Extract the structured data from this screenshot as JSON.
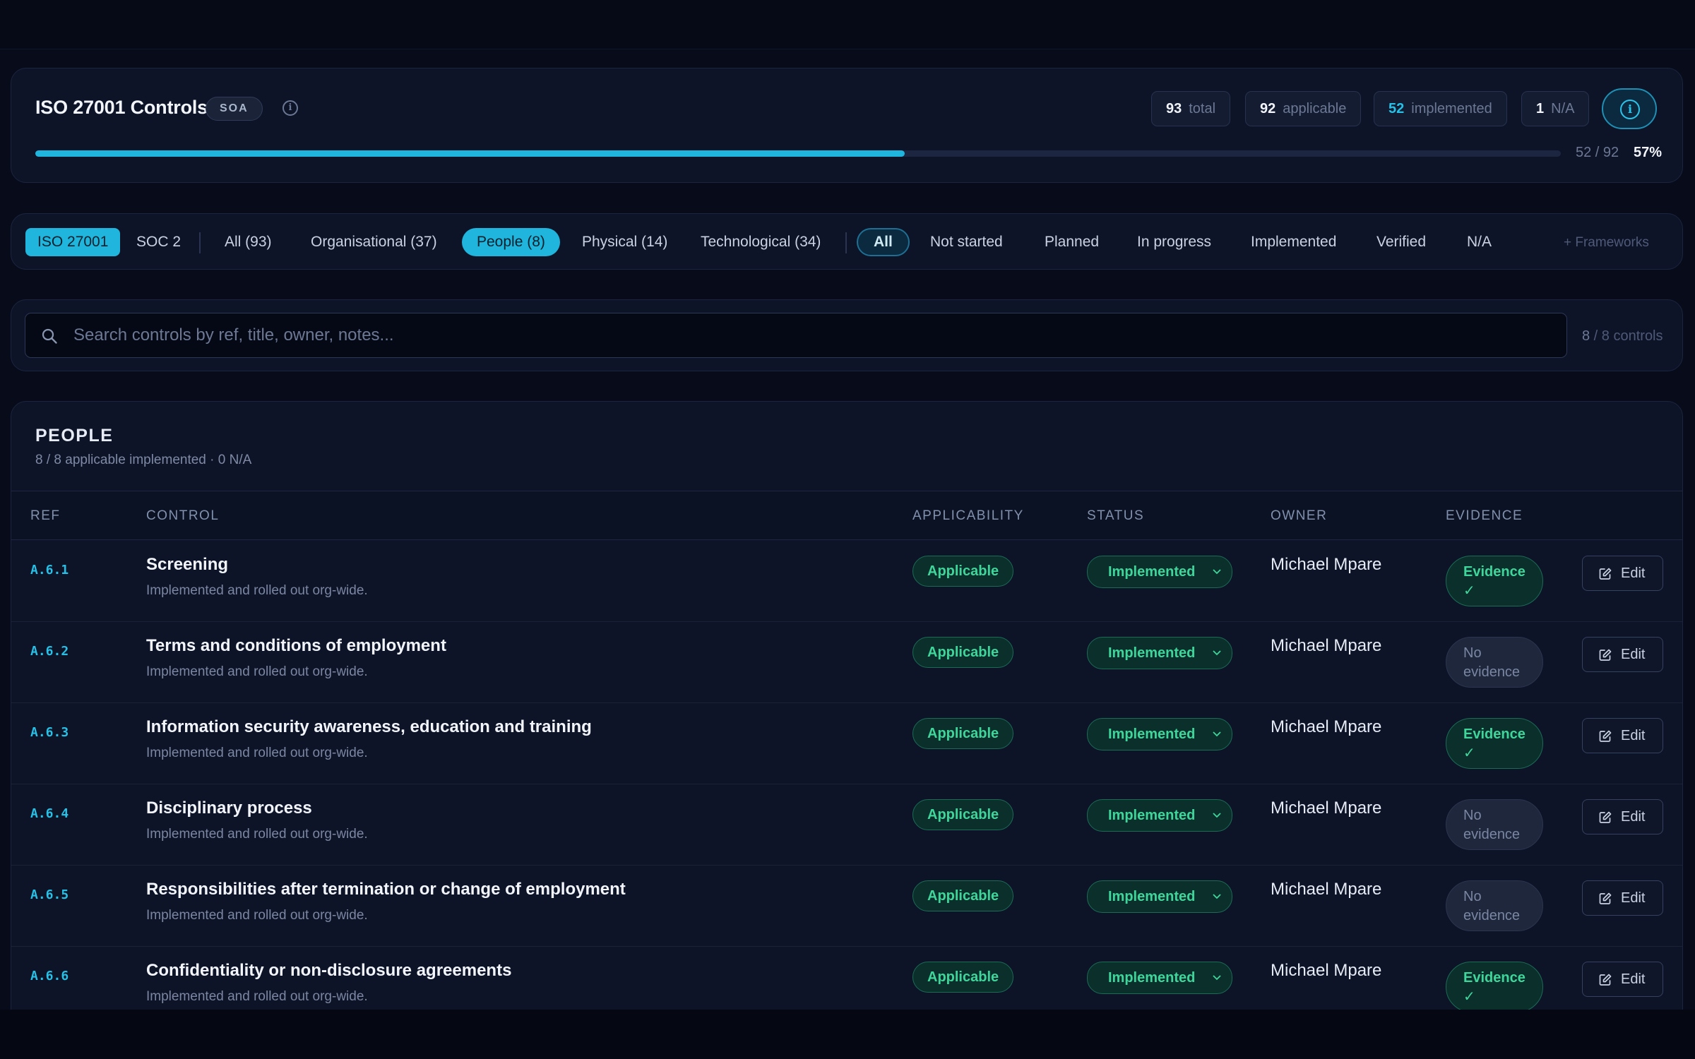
{
  "header": {
    "title": "ISO 27001 Controls",
    "badge": "SOA",
    "stats": [
      {
        "value": "93",
        "label": "total"
      },
      {
        "value": "92",
        "label": "applicable"
      },
      {
        "value": "52",
        "label": "implemented"
      },
      {
        "value": "1",
        "label": "N/A"
      }
    ],
    "progress": {
      "count": "52 / 92",
      "percent_label": "57%",
      "fraction": 0.57
    }
  },
  "filters": {
    "frameworks": [
      "ISO 27001",
      "SOC 2"
    ],
    "categories": [
      "All (93)",
      "Organisational (37)",
      "People (8)",
      "Physical (14)",
      "Technological (34)"
    ],
    "statuses": [
      "All",
      "Not started",
      "Planned",
      "In progress",
      "Implemented",
      "Verified",
      "N/A"
    ],
    "add_frameworks": "+ Frameworks"
  },
  "search": {
    "placeholder": "Search controls by ref, title, owner, notes...",
    "count_shown": "8",
    "count_rest": " / 8 controls"
  },
  "section": {
    "title": "PEOPLE",
    "subtitle": "8 / 8 applicable implemented · 0 N/A",
    "columns": [
      "REF",
      "CONTROL",
      "APPLICABILITY",
      "STATUS",
      "OWNER",
      "EVIDENCE"
    ]
  },
  "rows": [
    {
      "ref": "A.6.1",
      "title": "Screening",
      "note": "Implemented and rolled out org-wide.",
      "applicability": "Applicable",
      "status": "Implemented",
      "owner": "Michael Mpare",
      "evidence_line1": "Evidence",
      "evidence_line2": "✓",
      "has_evidence": true,
      "edit": "Edit"
    },
    {
      "ref": "A.6.2",
      "title": "Terms and conditions of employment",
      "note": "Implemented and rolled out org-wide.",
      "applicability": "Applicable",
      "status": "Implemented",
      "owner": "Michael Mpare",
      "evidence_line1": "No",
      "evidence_line2": "evidence",
      "has_evidence": false,
      "edit": "Edit"
    },
    {
      "ref": "A.6.3",
      "title": "Information security awareness, education and training",
      "note": "Implemented and rolled out org-wide.",
      "applicability": "Applicable",
      "status": "Implemented",
      "owner": "Michael Mpare",
      "evidence_line1": "Evidence",
      "evidence_line2": "✓",
      "has_evidence": true,
      "edit": "Edit"
    },
    {
      "ref": "A.6.4",
      "title": "Disciplinary process",
      "note": "Implemented and rolled out org-wide.",
      "applicability": "Applicable",
      "status": "Implemented",
      "owner": "Michael Mpare",
      "evidence_line1": "No",
      "evidence_line2": "evidence",
      "has_evidence": false,
      "edit": "Edit"
    },
    {
      "ref": "A.6.5",
      "title": "Responsibilities after termination or change of employment",
      "note": "Implemented and rolled out org-wide.",
      "applicability": "Applicable",
      "status": "Implemented",
      "owner": "Michael Mpare",
      "evidence_line1": "No",
      "evidence_line2": "evidence",
      "has_evidence": false,
      "edit": "Edit"
    },
    {
      "ref": "A.6.6",
      "title": "Confidentiality or non-disclosure agreements",
      "note": "Implemented and rolled out org-wide.",
      "applicability": "Applicable",
      "status": "Implemented",
      "owner": "Michael Mpare",
      "evidence_line1": "Evidence",
      "evidence_line2": "✓",
      "has_evidence": true,
      "edit": "Edit"
    }
  ],
  "icons": {
    "info": "info-icon",
    "search": "search-icon",
    "chevron": "chevron-down-icon",
    "edit": "edit-icon"
  },
  "colors": {
    "accent": "#1fb5dc",
    "success": "#3fd69b",
    "background": "#070b1a",
    "panel": "#0d1427"
  }
}
